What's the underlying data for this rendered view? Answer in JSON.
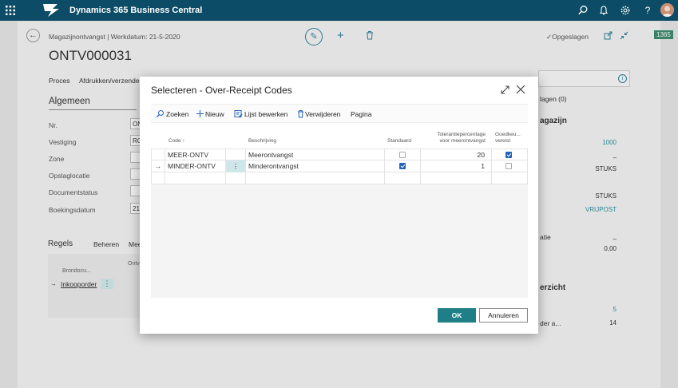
{
  "header": {
    "app_title": "Dynamics 365 Business Central"
  },
  "page": {
    "breadcrumb": "Magazijnontvangst | Werkdatum: 21-5-2020",
    "title": "ONTV000031",
    "saved_status": "✓Opgeslagen",
    "tag": "1365",
    "actions": [
      "Proces",
      "Afdrukken/verzenden"
    ],
    "section_title": "Algemeen",
    "fields": [
      {
        "label": "Nr.",
        "value": "ON"
      },
      {
        "label": "Vestiging",
        "value": "RO"
      },
      {
        "label": "Zone",
        "value": ""
      },
      {
        "label": "Opslaglocatie",
        "value": ""
      },
      {
        "label": "Documentstatus",
        "value": ""
      },
      {
        "label": "Boekingsdatum",
        "value": "21"
      }
    ],
    "lines": {
      "title": "Regels",
      "beheren": "Beheren",
      "mee": "Mee",
      "col1": "Brondocu...",
      "col2": "Ontv",
      "row_link": "Inkooporder"
    },
    "right_panel": {
      "lagen": "lagen (0)",
      "magazijn": "agazijn",
      "val_1000": "1000",
      "val_dash1": "–",
      "val_stuks1": "STUKS",
      "val_stuks2": "STUKS",
      "val_vrijpost": "VRIJPOST",
      "atie": "atie",
      "val_dash2": "–",
      "val_000": "0,00",
      "erzicht": "erzicht",
      "val_5": "5",
      "der_a": "der a...",
      "val_14": "14"
    }
  },
  "dialog": {
    "title": "Selecteren - Over-Receipt Codes",
    "toolbar": {
      "zoeken": "Zoeken",
      "nieuw": "Nieuw",
      "lijst_bewerken": "Lijst bewerken",
      "verwijderen": "Verwijderen",
      "pagina": "Pagina"
    },
    "columns": {
      "code": "Code ↑",
      "beschrijving": "Beschrijving",
      "standaard": "Standaard",
      "tolerantie_1": "Tolerantiepercentage",
      "tolerantie_2": "voor meerontvangst",
      "goedkeuring_1": "Goedkeu...",
      "goedkeuring_2": "vereist"
    },
    "rows": [
      {
        "code": "MEER-ONTV",
        "beschrijving": "Meerontvangst",
        "standaard": false,
        "tolerantie": "20",
        "goedkeuring": true
      },
      {
        "code": "MINDER-ONTV",
        "beschrijving": "Minderontvangst",
        "standaard": true,
        "tolerantie": "1",
        "goedkeuring": false
      }
    ],
    "ok_label": "OK",
    "cancel_label": "Annuleren"
  },
  "colors": {
    "topbar": "#0d4c66",
    "accent": "#1f7f87",
    "checkbox": "#2664b8"
  }
}
